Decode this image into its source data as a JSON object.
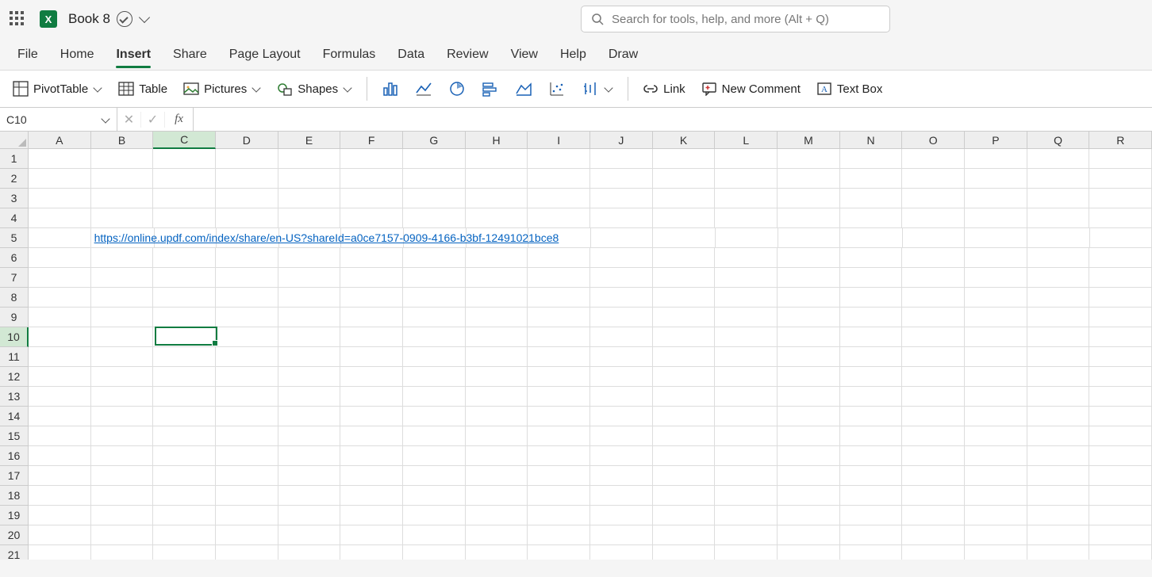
{
  "titlebar": {
    "excel_letter": "X",
    "doc_title": "Book 8"
  },
  "search": {
    "placeholder": "Search for tools, help, and more (Alt + Q)"
  },
  "tabs": [
    "File",
    "Home",
    "Insert",
    "Share",
    "Page Layout",
    "Formulas",
    "Data",
    "Review",
    "View",
    "Help",
    "Draw"
  ],
  "active_tab_index": 2,
  "ribbon": {
    "pivottable": "PivotTable",
    "table": "Table",
    "pictures": "Pictures",
    "shapes": "Shapes",
    "link": "Link",
    "newcomment": "New Comment",
    "textbox": "Text Box"
  },
  "namebox": "C10",
  "columns": [
    "A",
    "B",
    "C",
    "D",
    "E",
    "F",
    "G",
    "H",
    "I",
    "J",
    "K",
    "L",
    "M",
    "N",
    "O",
    "P",
    "Q",
    "R"
  ],
  "rows": [
    1,
    2,
    3,
    4,
    5,
    6,
    7,
    8,
    9,
    10,
    11,
    12,
    13,
    14,
    15,
    16,
    17,
    18,
    19,
    20,
    21
  ],
  "selected_col_index": 2,
  "selected_row_index": 9,
  "cell_data": {
    "B5": {
      "text": "https://online.updf.com/index/share/en-US?shareId=a0ce7157-0909-4166-b3bf-12491021bce8",
      "is_link": true
    }
  }
}
